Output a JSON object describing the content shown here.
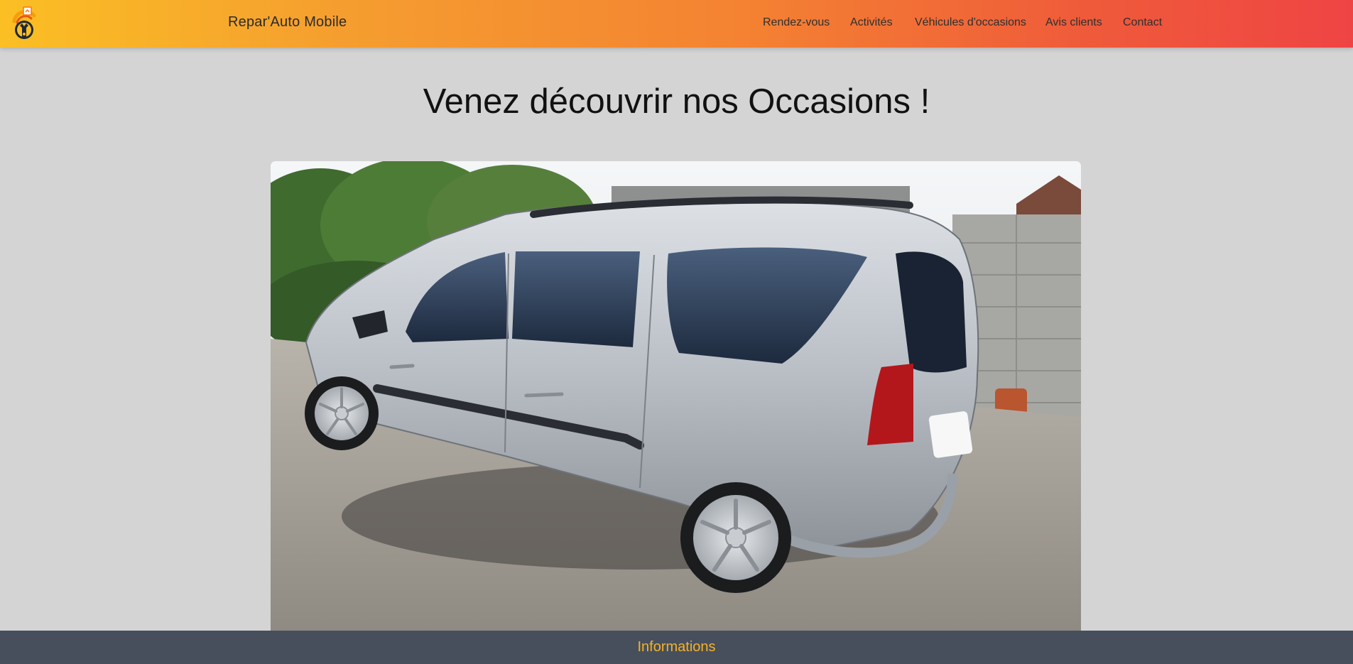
{
  "navbar": {
    "brand": "Repar'Auto Mobile",
    "logo_icon": "wrench-car-logo-icon",
    "links": [
      "Rendez-vous",
      "Activités",
      "Véhicules d'occasions",
      "Avis clients",
      "Contact"
    ]
  },
  "main": {
    "title": "Venez découvrir nos Occasions !",
    "photo_icon": "silver-station-wagon-photo"
  },
  "footer": {
    "label": "Informations"
  },
  "colors": {
    "gradient_start": "#fbbf24",
    "gradient_end": "#ef4444",
    "page_background": "#d4d4d4",
    "footer_background": "#474f5c",
    "footer_text": "#f5b225"
  }
}
